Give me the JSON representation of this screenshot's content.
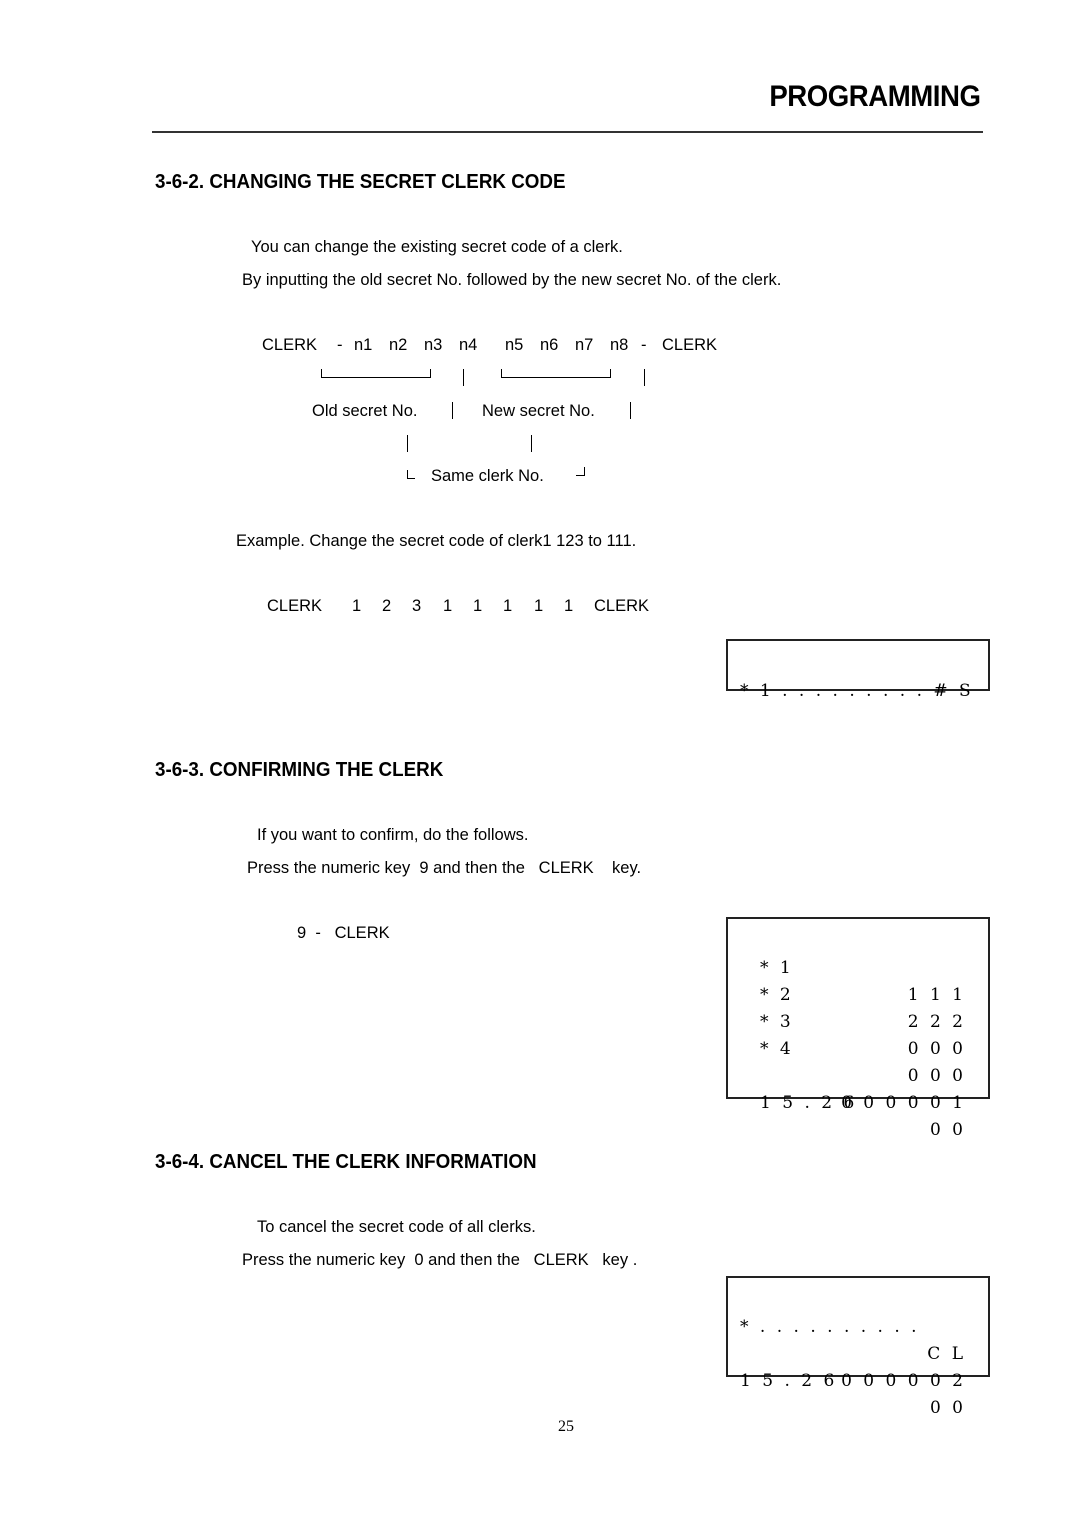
{
  "header": {
    "title": "PROGRAMMING"
  },
  "section_362": {
    "heading": "3-6-2. CHANGING THE SECRET CLERK CODE",
    "paragraphs": [
      "You can change the existing secret code of a clerk.",
      "By inputting the old secret No. followed by the new secret No. of the clerk."
    ],
    "diagram": {
      "sequence": [
        "CLERK",
        "-",
        "n1",
        "n2",
        "n3",
        "n4",
        "n5",
        "n6",
        "n7",
        "n8",
        "-",
        "CLERK"
      ],
      "old_label": "Old secret No.",
      "new_label": "New secret No.",
      "same_label": "Same clerk No."
    },
    "example_text": "Example. Change the secret code of clerk1 123 to 111.",
    "example_keys": [
      "CLERK",
      "1",
      "2",
      "3",
      "1",
      "1",
      "1",
      "1",
      "1",
      "CLERK"
    ],
    "display": {
      "line": "* 1 . . . . . . . . . # S"
    }
  },
  "section_363": {
    "heading": "3-6-3. CONFIRMING THE CLERK",
    "paragraphs": [
      "If you want to confirm, do the follows.",
      "Press the numeric key  9 and then the   CLERK    key."
    ],
    "key_sequence": "9  -   CLERK",
    "display": {
      "rows": [
        {
          "left": "* 1",
          "right": "1 1 1"
        },
        {
          "left": "* 2",
          "right": "2 2 2"
        },
        {
          "left": "* 3",
          "right": "0 0 0"
        },
        {
          "left": "* 4",
          "right": "0 0 0"
        },
        {
          "left": "",
          "right": "0 0 0 0 0 1"
        },
        {
          "left": "1 5 . 2 6",
          "right": "0 0"
        }
      ]
    }
  },
  "section_364": {
    "heading": "3-6-4. CANCEL THE CLERK INFORMATION",
    "paragraphs": [
      "To cancel the secret code of all clerks.",
      "Press the numeric key  0 and then the   CLERK   key ."
    ],
    "display": {
      "rows": [
        {
          "left": "* . . . . . . . . . .",
          "right": "C L"
        },
        {
          "left": "",
          "right": "0 0 0 0 0 2"
        },
        {
          "left": "1 5 . 2 6",
          "right": "0 0"
        }
      ]
    }
  },
  "footer": {
    "page_number": "25"
  }
}
